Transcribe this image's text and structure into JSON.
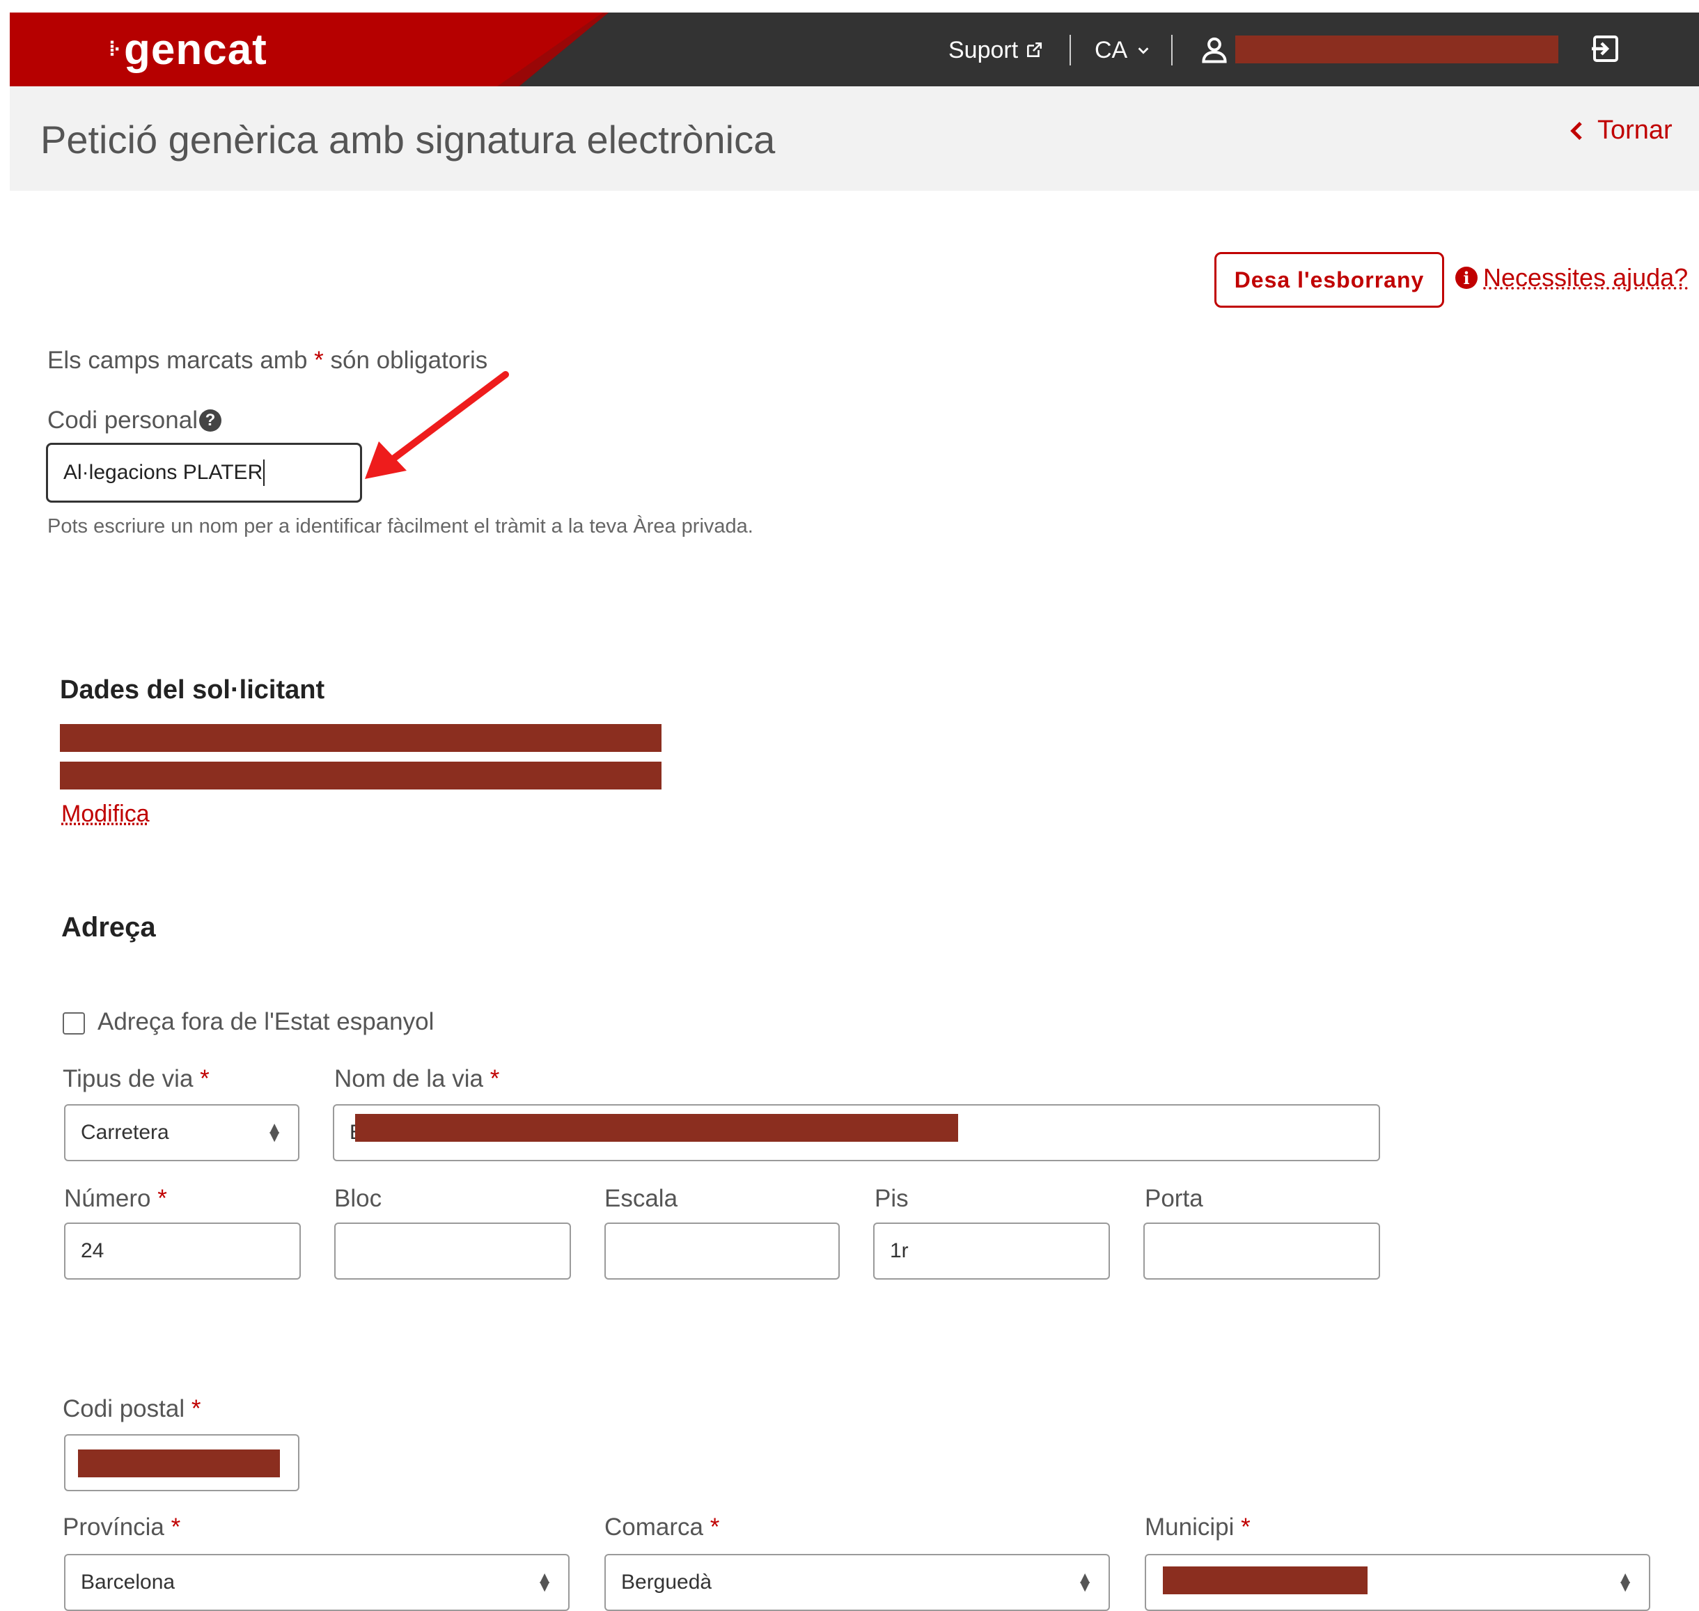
{
  "topbar": {
    "logo_text": "gencat",
    "logo_dots": "⁞·",
    "support_label": "Suport",
    "language": "CA",
    "colors": {
      "brand_red": "#b60000",
      "bar_dark": "#333333"
    }
  },
  "header": {
    "title": "Petició genèrica amb signatura electrònica",
    "back_label": "Tornar"
  },
  "actions": {
    "save_draft_label": "Desa l'esborrany",
    "help_label": "Necessites ajuda?"
  },
  "form": {
    "required_note_prefix": "Els camps marcats amb",
    "required_note_star": "*",
    "required_note_suffix": "són obligatoris",
    "personal_code": {
      "label": "Codi personal",
      "value": "Al·legacions PLATER",
      "hint": "Pots escriure un nom per a identificar fàcilment el tràmit a la teva Àrea privada."
    }
  },
  "applicant": {
    "section_title": "Dades del sol·licitant",
    "modify_label": "Modifica"
  },
  "address": {
    "section_title": "Adreça",
    "foreign_checkbox_label": "Adreça fora de l'Estat espanyol",
    "foreign_checkbox_checked": false,
    "street_type": {
      "label": "Tipus de via",
      "value": "Carretera"
    },
    "street_name": {
      "label": "Nom de la via",
      "visible_prefix": "E"
    },
    "number": {
      "label": "Número",
      "value": "24"
    },
    "block": {
      "label": "Bloc",
      "value": ""
    },
    "stair": {
      "label": "Escala",
      "value": ""
    },
    "floor": {
      "label": "Pis",
      "value": "1r"
    },
    "door": {
      "label": "Porta",
      "value": ""
    },
    "postal_code": {
      "label": "Codi postal"
    },
    "province": {
      "label": "Província",
      "value": "Barcelona"
    },
    "county": {
      "label": "Comarca",
      "value": "Berguedà"
    },
    "municipality": {
      "label": "Municipi"
    }
  },
  "colors": {
    "accent": "#c00000",
    "redaction": "#8b2e1f",
    "annotation_arrow": "#ee1c1c"
  }
}
